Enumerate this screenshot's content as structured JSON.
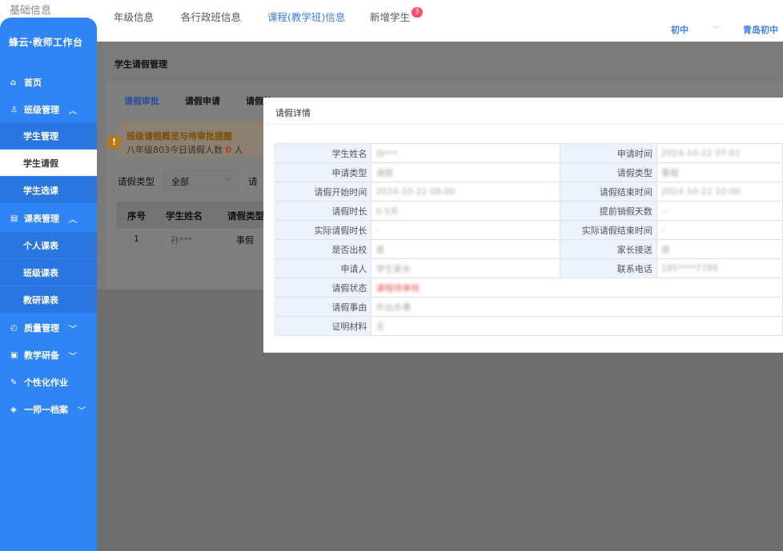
{
  "breadcrumb": "基础信息",
  "top_tabs": [
    {
      "label": "年级信息"
    },
    {
      "label": "各行政班信息"
    },
    {
      "label": "课程(教学班)信息"
    },
    {
      "label": "新增学生",
      "badge": "3"
    }
  ],
  "top_right": {
    "level": "初中",
    "school": "青岛初中"
  },
  "sidebar": {
    "title": "蜂云·教师工作台",
    "items": {
      "home": "首页",
      "class_mgmt": "班级管理",
      "student_mgmt": "学生管理",
      "student_leave": "学生请假",
      "student_course": "学生选课",
      "schedule_mgmt": "课表管理",
      "personal_schedule": "个人课表",
      "class_schedule": "班级课表",
      "research_schedule": "教研课表",
      "quality_mgmt": "质量管理",
      "teaching_research": "教学研备",
      "personal_homework": "个性化作业",
      "teacher_profile": "一师一档案"
    }
  },
  "main": {
    "page_title": "学生请假管理",
    "sub_tabs": [
      "请假审批",
      "请假申请",
      "请假统"
    ],
    "warning": {
      "title": "班级请假概览与待审批提醒",
      "text_prefix": "八年级803今日请假人数",
      "count": "0",
      "text_suffix": "人"
    },
    "filter": {
      "label": "请假类型",
      "value": "全部",
      "label2": "请"
    },
    "table": {
      "headers": [
        "序号",
        "学生姓名",
        "请假类型"
      ],
      "rows": [
        {
          "index": "1",
          "name": "孙***",
          "type": "事假"
        }
      ]
    }
  },
  "modal": {
    "title": "请假详情",
    "fields": {
      "student_name": {
        "label": "学生姓名",
        "value": "孙***"
      },
      "apply_time": {
        "label": "申请时间",
        "value": "2024-10-22 07:01"
      },
      "apply_type": {
        "label": "申请类型",
        "value": "请假"
      },
      "leave_type": {
        "label": "请假类型",
        "value": "事假"
      },
      "start_time": {
        "label": "请假开始时间",
        "value": "2024-10-22 08:00"
      },
      "end_time": {
        "label": "请假结束时间",
        "value": "2024-10-22 10:00"
      },
      "duration": {
        "label": "请假时长",
        "value": "0.5天"
      },
      "advance_days": {
        "label": "提前销假天数",
        "value": "--"
      },
      "actual_duration": {
        "label": "实际请假时长",
        "value": "-"
      },
      "actual_end": {
        "label": "实际请假结束时间",
        "value": "-"
      },
      "leave_school": {
        "label": "是否出校",
        "value": "是"
      },
      "parent_pickup": {
        "label": "家长接送",
        "value": "是"
      },
      "applicant": {
        "label": "申请人",
        "value": "学生家长"
      },
      "phone": {
        "label": "联系电话",
        "value": "185****7789"
      },
      "status": {
        "label": "请假状态",
        "value": "课程待审核"
      },
      "reason": {
        "label": "请假事由",
        "value": "外出办事"
      },
      "proof": {
        "label": "证明材料",
        "value": "无"
      }
    }
  }
}
